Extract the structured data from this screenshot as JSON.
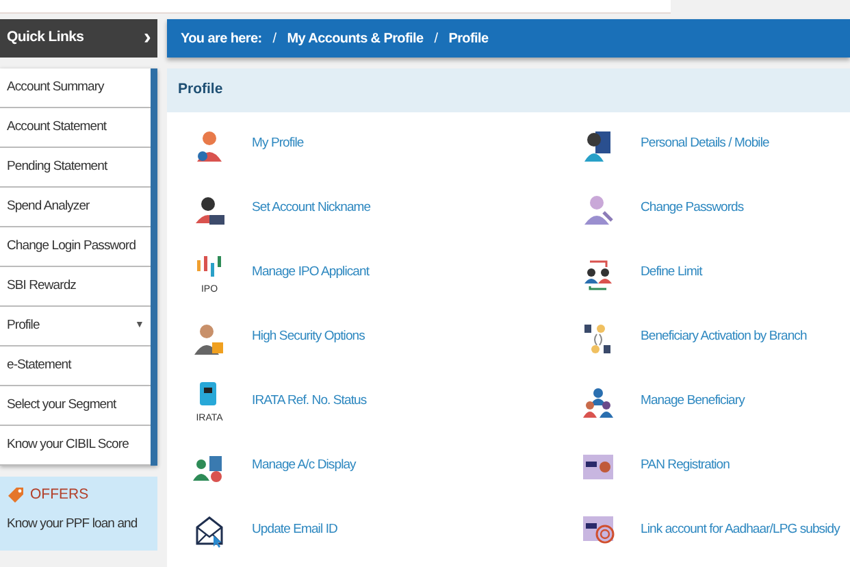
{
  "sidebar": {
    "title": "Quick Links",
    "toggle": "›",
    "items": [
      {
        "label": "Account Summary"
      },
      {
        "label": "Account Statement"
      },
      {
        "label": "Pending Statement"
      },
      {
        "label": "Spend Analyzer"
      },
      {
        "label": "Change Login Password"
      },
      {
        "label": "SBI Rewardz"
      },
      {
        "label": "Profile",
        "caret": "▼"
      },
      {
        "label": "e-Statement"
      },
      {
        "label": "Select your Segment"
      },
      {
        "label": "Know your CIBIL Score"
      }
    ],
    "offers": {
      "title": "OFFERS",
      "text": "Know your PPF loan and"
    }
  },
  "breadcrumb": {
    "label": "You are here:",
    "items": [
      {
        "separator": "/",
        "label": "My Accounts & Profile"
      },
      {
        "separator": "/",
        "label": "Profile"
      }
    ]
  },
  "panel": {
    "title": "Profile",
    "links": [
      {
        "label": "My Profile"
      },
      {
        "label": "Personal Details / Mobile"
      },
      {
        "label": "Set Account Nickname"
      },
      {
        "label": "Change Passwords"
      },
      {
        "label": "Manage IPO Applicant",
        "caption": "IPO"
      },
      {
        "label": "Define Limit"
      },
      {
        "label": "High Security Options"
      },
      {
        "label": "Beneficiary Activation by Branch"
      },
      {
        "label": "IRATA Ref. No. Status",
        "caption": "IRATA"
      },
      {
        "label": "Manage Beneficiary"
      },
      {
        "label": "Manage A/c Display"
      },
      {
        "label": "PAN Registration"
      },
      {
        "label": "Update Email ID"
      },
      {
        "label": "Link account for Aadhaar/LPG subsidy"
      }
    ]
  }
}
